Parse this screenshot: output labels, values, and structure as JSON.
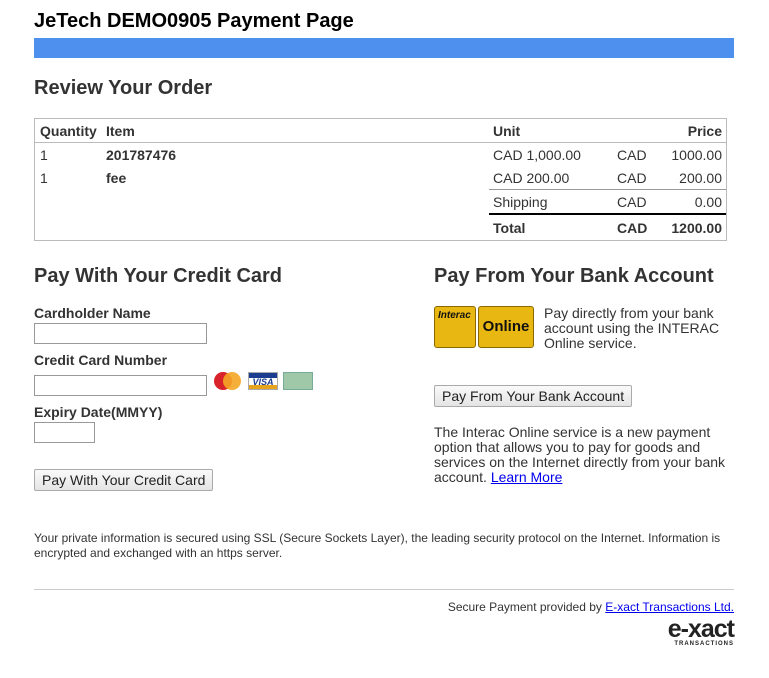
{
  "title": "JeTech DEMO0905 Payment Page",
  "accent": "#4d90ee",
  "review": {
    "heading": "Review Your Order",
    "headers": {
      "quantity": "Quantity",
      "item": "Item",
      "unit": "Unit",
      "price": "Price"
    },
    "rows": [
      {
        "quantity": "1",
        "item": "201787476",
        "unit": "CAD 1,000.00",
        "currency": "CAD",
        "price": "1000.00"
      },
      {
        "quantity": "1",
        "item": "fee",
        "unit": "CAD 200.00",
        "currency": "CAD",
        "price": "200.00"
      }
    ],
    "shipping": {
      "label": "Shipping",
      "currency": "CAD",
      "price": "0.00"
    },
    "total": {
      "label": "Total",
      "currency": "CAD",
      "price": "1200.00"
    }
  },
  "credit": {
    "heading": "Pay With Your Credit Card",
    "name_label": "Cardholder Name",
    "number_label": "Credit Card Number",
    "expiry_label": "Expiry Date(MMYY)",
    "button": "Pay With Your Credit Card",
    "cards": [
      "mastercard-icon",
      "visa-icon",
      "amex-icon"
    ]
  },
  "bank": {
    "heading": "Pay From Your Bank Account",
    "logo_interac": "Interac",
    "logo_online": "Online",
    "description": "Pay directly from your bank account using the INTERAC Online service.",
    "button": "Pay From Your Bank Account",
    "info": "The Interac Online service is a new payment option that allows you to pay for goods and services on the Internet directly from your bank account.",
    "learn_more": "Learn More"
  },
  "security_note": "Your private information is secured using SSL (Secure Sockets Layer), the leading security protocol on the Internet. Information is encrypted and exchanged with an https server.",
  "footer": {
    "provided_by": "Secure Payment provided by",
    "provider_link": "E-xact Transactions Ltd.",
    "logo_main": "e-xact",
    "logo_sub": "TRANSACTIONS"
  }
}
